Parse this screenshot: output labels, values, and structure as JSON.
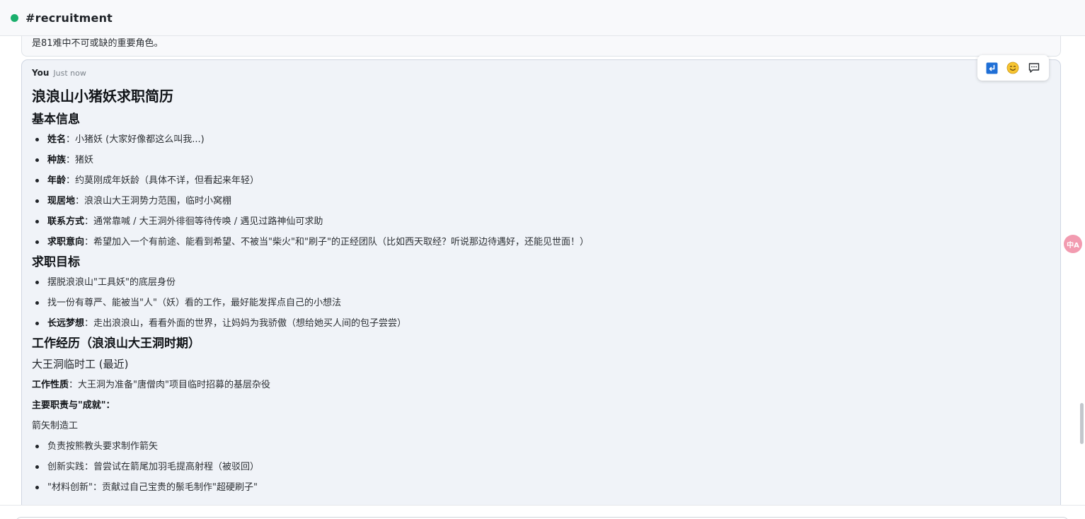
{
  "header": {
    "channel": "#recruitment"
  },
  "previous_message": {
    "text": "是81难中不可或缺的重要角色。"
  },
  "message": {
    "author": "You",
    "timestamp": "Just now",
    "title": "浪浪山小猪妖求职简历",
    "basic_info": {
      "heading": "基本信息",
      "items": [
        {
          "label": "姓名",
          "sep": "：",
          "value": "小猪妖 (大家好像都这么叫我...)"
        },
        {
          "label": "种族",
          "sep": "：",
          "value": "猪妖"
        },
        {
          "label": "年龄",
          "sep": "：",
          "value": "约莫刚成年妖龄（具体不详，但看起来年轻）"
        },
        {
          "label": "现居地",
          "sep": "：",
          "value": "浪浪山大王洞势力范围，临时小窝棚"
        },
        {
          "label": "联系方式",
          "sep": "：",
          "value": "通常靠喊 / 大王洞外徘徊等待传唤 / 遇见过路神仙可求助"
        },
        {
          "label": "求职意向",
          "sep": "：",
          "value": "希望加入一个有前途、能看到希望、不被当\"柴火\"和\"刷子\"的正经团队（比如西天取经？听说那边待遇好，还能见世面！）"
        }
      ]
    },
    "goals": {
      "heading": "求职目标",
      "items": [
        {
          "text": "摆脱浪浪山\"工具妖\"的底层身份"
        },
        {
          "text": "找一份有尊严、能被当\"人\"（妖）看的工作，最好能发挥点自己的小想法"
        },
        {
          "label": "长远梦想",
          "sep": "：",
          "value": "走出浪浪山，看看外面的世界，让妈妈为我骄傲（想给她买人间的包子尝尝）"
        }
      ]
    },
    "experience": {
      "heading": "工作经历（浪浪山大王洞时期）",
      "job_title": "大王洞临时工 (最近)",
      "nature_label": "工作性质",
      "nature_sep": "：",
      "nature_value": "大王洞为准备\"唐僧肉\"项目临时招募的基层杂役",
      "duties_label": "主要职责与\"成就\"",
      "duties_sep": "：",
      "role": "箭矢制造工",
      "items": [
        {
          "text": "负责按熊教头要求制作箭矢"
        },
        {
          "text": "创新实践：曾尝试在箭尾加羽毛提高射程（被驳回）"
        },
        {
          "text": "\"材料创新\"：贡献过自己宝贵的鬃毛制作\"超硬刷子\""
        }
      ]
    }
  },
  "toolbar": {
    "icons": [
      "reply-icon",
      "emoji-icon",
      "comment-icon"
    ]
  },
  "float_button": {
    "label": "中A"
  }
}
